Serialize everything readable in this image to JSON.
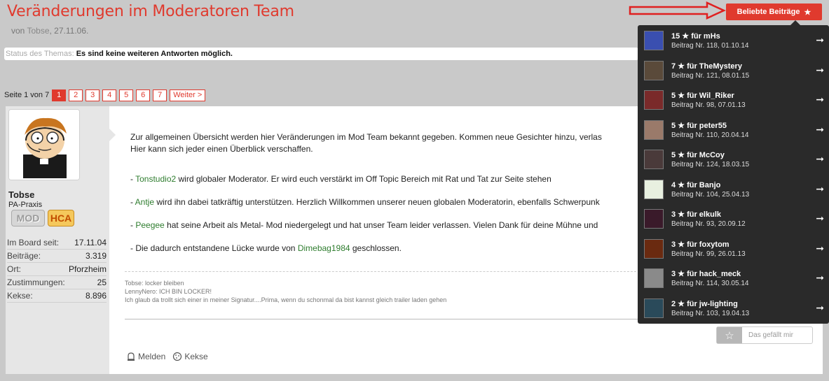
{
  "thread": {
    "title": "Veränderungen im Moderatoren Team",
    "by_prefix": "von",
    "author": "Tobse",
    "date": ", 27.11.06."
  },
  "status": {
    "label": "Status des Themas:",
    "text": "Es sind keine weiteren Antworten möglich."
  },
  "pagination": {
    "info": "Seite 1 von 7",
    "pages": [
      "1",
      "2",
      "3",
      "4",
      "5",
      "6",
      "7"
    ],
    "current": "1",
    "next": "Weiter >"
  },
  "user": {
    "name": "Tobse",
    "title": "PA-Praxis",
    "badge_mod": "MOD",
    "badge_hca": "HCA",
    "stats": [
      {
        "k": "Im Board seit:",
        "v": "17.11.04"
      },
      {
        "k": "Beiträge:",
        "v": "3.319"
      },
      {
        "k": "Ort:",
        "v": "Pforzheim"
      },
      {
        "k": "Zustimmungen:",
        "v": "25"
      },
      {
        "k": "Kekse:",
        "v": "8.896"
      }
    ]
  },
  "post": {
    "intro": "Zur allgemeinen Übersicht werden hier Veränderungen im Mod Team bekannt gegeben. Kommen neue Gesichter hinzu, verlas",
    "intro2": "Hier kann sich jeder einen Überblick verschaffen.",
    "items": [
      {
        "prefix": "- ",
        "user": "Tonstudio2",
        "text": " wird globaler Moderator. Er wird euch verstärkt im Off Topic Bereich mit Rat und Tat zur Seite stehen"
      },
      {
        "prefix": "- ",
        "user": "Antje",
        "text": " wird ihn dabei tatkräftig unterstützen. Herzlich Willkommen unserer neuen globalen Moderatorin, ebenfalls Schwerpunk"
      },
      {
        "prefix": "- ",
        "user": "Peegee",
        "text": " hat seine Arbeit als Metal- Mod niedergelegt und hat unser Team leider verlassen. Vielen Dank für deine Mühne und"
      },
      {
        "prefix": "- Die dadurch entstandene Lücke wurde von ",
        "user": "Dimebag1984",
        "text": " geschlossen."
      }
    ],
    "signature": [
      "Tobse: locker bleiben",
      "LennyNero: ICH BIN LOCKER!",
      "Ich glaub da trollt sich einer in meiner Signatur....Prima, wenn du schonmal da bist kannst gleich trailer laden gehen"
    ],
    "report": "Melden",
    "cookies": "Kekse",
    "like": "Das gefällt mir"
  },
  "popular": {
    "button": "Beliebte Beiträge",
    "items": [
      {
        "title": "15 ★ für mHs",
        "sub": "Beitrag Nr. 118, 01.10.14",
        "color": "#3a4fb0"
      },
      {
        "title": "7 ★ für TheMystery",
        "sub": "Beitrag Nr. 121, 08.01.15",
        "color": "#5a4a3a"
      },
      {
        "title": "5 ★ für Wil_Riker",
        "sub": "Beitrag Nr. 98, 07.01.13",
        "color": "#7a2a2a"
      },
      {
        "title": "5 ★ für peter55",
        "sub": "Beitrag Nr. 110, 20.04.14",
        "color": "#9a7a6a"
      },
      {
        "title": "5 ★ für McCoy",
        "sub": "Beitrag Nr. 124, 18.03.15",
        "color": "#4a3a3a"
      },
      {
        "title": "4 ★ für Banjo",
        "sub": "Beitrag Nr. 104, 25.04.13",
        "color": "#e8f0e0"
      },
      {
        "title": "3 ★ für elkulk",
        "sub": "Beitrag Nr. 93, 20.09.12",
        "color": "#3a1a2a"
      },
      {
        "title": "3 ★ für foxytom",
        "sub": "Beitrag Nr. 99, 26.01.13",
        "color": "#6a2a10"
      },
      {
        "title": "3 ★ für hack_meck",
        "sub": "Beitrag Nr. 114, 30.05.14",
        "color": "#8a8a8a"
      },
      {
        "title": "2 ★ für jw-lighting",
        "sub": "Beitrag Nr. 103, 19.04.13",
        "color": "#2a4a5a"
      }
    ]
  }
}
